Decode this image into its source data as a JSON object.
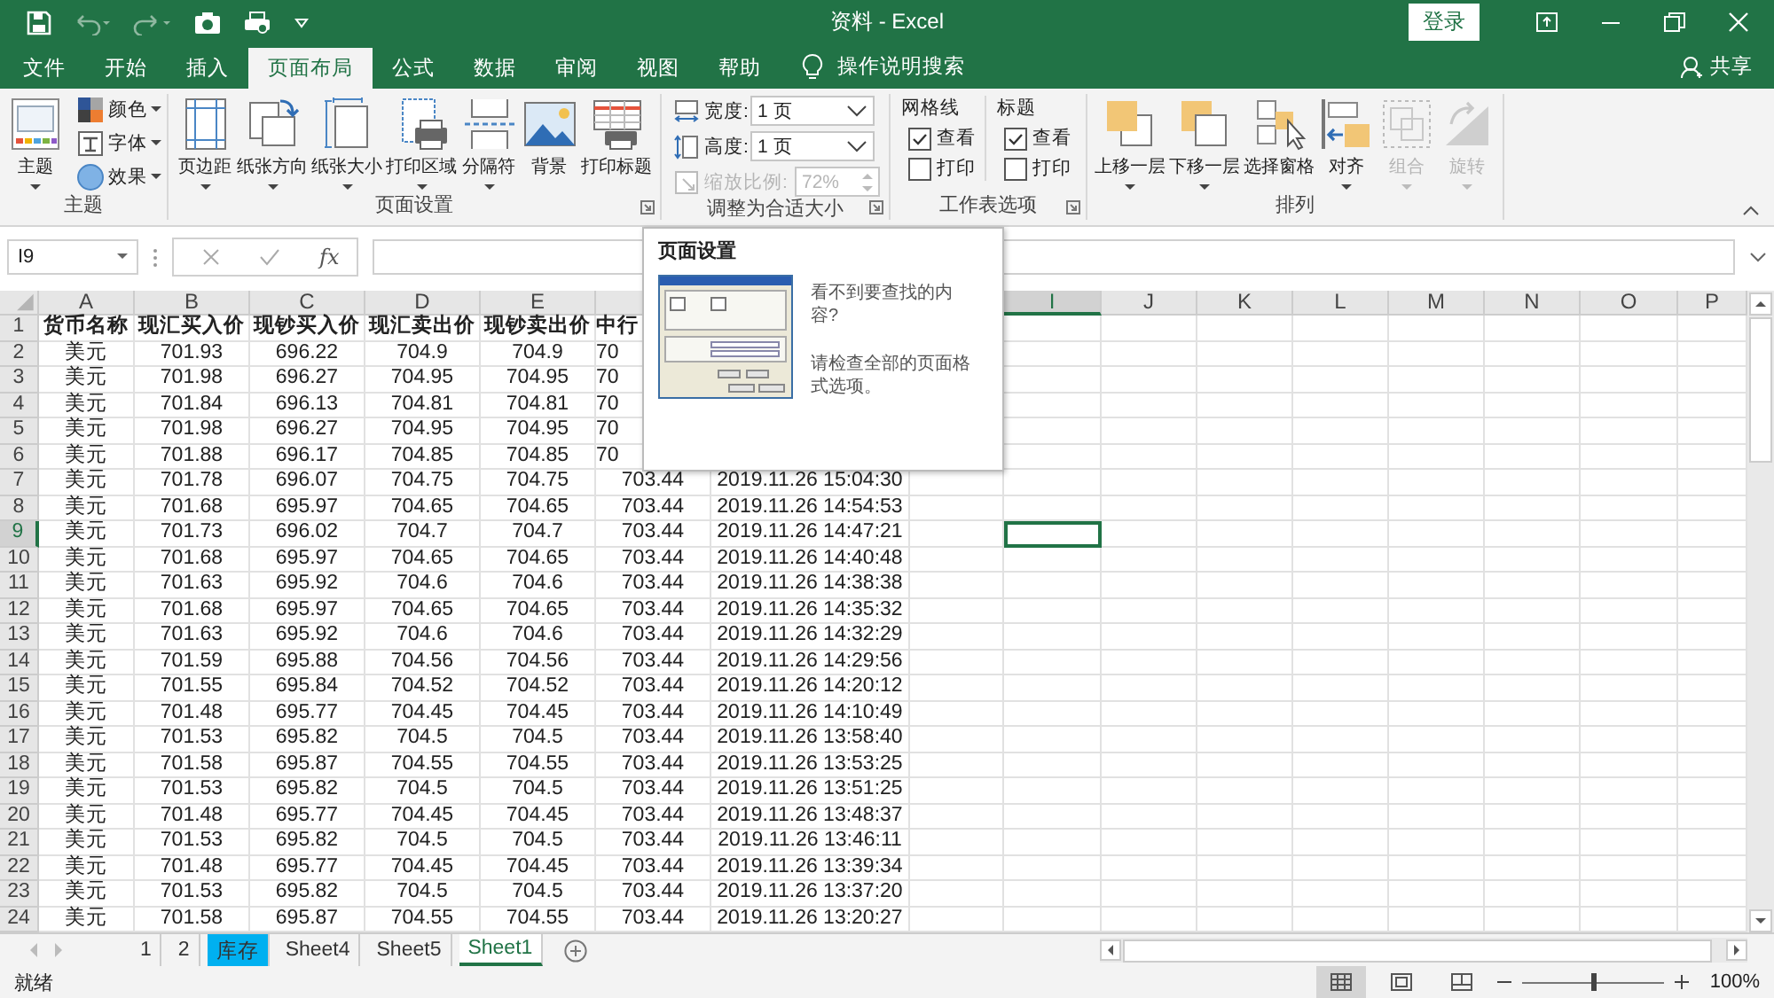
{
  "title_bar": {
    "title": "资料 - Excel",
    "login": "登录"
  },
  "tabs": [
    {
      "label": "文件",
      "selected": false
    },
    {
      "label": "开始",
      "selected": false
    },
    {
      "label": "插入",
      "selected": false
    },
    {
      "label": "页面布局",
      "selected": true
    },
    {
      "label": "公式",
      "selected": false
    },
    {
      "label": "数据",
      "selected": false
    },
    {
      "label": "审阅",
      "selected": false
    },
    {
      "label": "视图",
      "selected": false
    },
    {
      "label": "帮助",
      "selected": false
    }
  ],
  "tell_me": "操作说明搜索",
  "share": "共享",
  "ribbon": [
    {
      "kind": "buttons",
      "label": "主题",
      "launcher": false,
      "items": [
        {
          "label": "主题",
          "dropdown": true,
          "disabled": false
        }
      ],
      "small_items": [
        {
          "label": "颜色",
          "dropdown": true,
          "disabled": false
        },
        {
          "label": "字体",
          "dropdown": true,
          "disabled": false
        },
        {
          "label": "效果",
          "dropdown": true,
          "disabled": false
        }
      ]
    },
    {
      "kind": "buttons",
      "label": "页面设置",
      "launcher": true,
      "items": [
        {
          "label": "页边距",
          "dropdown": true,
          "disabled": false
        },
        {
          "label": "纸张方向",
          "dropdown": true,
          "disabled": false
        },
        {
          "label": "纸张大小",
          "dropdown": true,
          "disabled": false
        },
        {
          "label": "打印区域",
          "dropdown": true,
          "disabled": false
        },
        {
          "label": "分隔符",
          "dropdown": true,
          "disabled": false
        },
        {
          "label": "背景",
          "dropdown": false,
          "disabled": false
        },
        {
          "label": "打印标题",
          "dropdown": false,
          "disabled": false
        }
      ]
    },
    {
      "kind": "fit",
      "label": "调整为合适大小",
      "launcher": true,
      "fields": [
        {
          "kind": "dropdown",
          "label": "宽度:",
          "value": "1 页",
          "disabled": false
        },
        {
          "kind": "dropdown",
          "label": "高度:",
          "value": "1 页",
          "disabled": false
        },
        {
          "kind": "spin",
          "label": "缩放比例:",
          "value": "72%",
          "disabled": true
        }
      ]
    },
    {
      "kind": "options",
      "label": "工作表选项",
      "launcher": true,
      "columns": [
        {
          "title": "网格线",
          "checks": [
            {
              "label": "查看",
              "checked": true
            },
            {
              "label": "打印",
              "checked": false
            }
          ]
        },
        {
          "title": "标题",
          "checks": [
            {
              "label": "查看",
              "checked": true
            },
            {
              "label": "打印",
              "checked": false
            }
          ]
        }
      ]
    },
    {
      "kind": "buttons",
      "label": "排列",
      "launcher": false,
      "items": [
        {
          "label": "上移一层",
          "dropdown": true,
          "disabled": false
        },
        {
          "label": "下移一层",
          "dropdown": true,
          "disabled": false
        },
        {
          "label": "选择窗格",
          "dropdown": false,
          "disabled": false
        },
        {
          "label": "对齐",
          "dropdown": true,
          "disabled": false
        },
        {
          "label": "组合",
          "dropdown": true,
          "disabled": true
        },
        {
          "label": "旋转",
          "dropdown": true,
          "disabled": true
        }
      ]
    }
  ],
  "formula_bar": {
    "name_box": "I9",
    "function_label": "fx"
  },
  "columns": [
    {
      "label": "A",
      "selected": false
    },
    {
      "label": "B",
      "selected": false
    },
    {
      "label": "C",
      "selected": false
    },
    {
      "label": "D",
      "selected": false
    },
    {
      "label": "E",
      "selected": false
    },
    null,
    null,
    null,
    {
      "label": "I",
      "selected": true
    },
    {
      "label": "J",
      "selected": false
    },
    {
      "label": "K",
      "selected": false
    },
    {
      "label": "L",
      "selected": false
    },
    {
      "label": "M",
      "selected": false
    },
    {
      "label": "N",
      "selected": false
    },
    {
      "label": "O",
      "selected": false
    },
    {
      "label": "P",
      "selected": false
    }
  ],
  "rows": [
    {
      "n": "1",
      "selected": false,
      "cells": [
        "货币名称",
        "现汇买入价",
        "现钞买入价",
        "现汇卖出价",
        "现钞卖出价",
        "中行"
      ]
    },
    {
      "n": "2",
      "selected": false,
      "cells": [
        "美元",
        "701.93",
        "696.22",
        "704.9",
        "704.9",
        "70"
      ]
    },
    {
      "n": "3",
      "selected": false,
      "cells": [
        "美元",
        "701.98",
        "696.27",
        "704.95",
        "704.95",
        "70"
      ]
    },
    {
      "n": "4",
      "selected": false,
      "cells": [
        "美元",
        "701.84",
        "696.13",
        "704.81",
        "704.81",
        "70"
      ]
    },
    {
      "n": "5",
      "selected": false,
      "cells": [
        "美元",
        "701.98",
        "696.27",
        "704.95",
        "704.95",
        "70"
      ]
    },
    {
      "n": "6",
      "selected": false,
      "cells": [
        "美元",
        "701.88",
        "696.17",
        "704.85",
        "704.85",
        "70"
      ]
    },
    {
      "n": "7",
      "selected": false,
      "cells": [
        "美元",
        "701.78",
        "696.07",
        "704.75",
        "704.75",
        "703.44",
        "2019.11.26 15:04:30"
      ]
    },
    {
      "n": "8",
      "selected": false,
      "cells": [
        "美元",
        "701.68",
        "695.97",
        "704.65",
        "704.65",
        "703.44",
        "2019.11.26 14:54:53"
      ]
    },
    {
      "n": "9",
      "selected": true,
      "cells": [
        "美元",
        "701.73",
        "696.02",
        "704.7",
        "704.7",
        "703.44",
        "2019.11.26 14:47:21"
      ]
    },
    {
      "n": "10",
      "selected": false,
      "cells": [
        "美元",
        "701.68",
        "695.97",
        "704.65",
        "704.65",
        "703.44",
        "2019.11.26 14:40:48"
      ]
    },
    {
      "n": "11",
      "selected": false,
      "cells": [
        "美元",
        "701.63",
        "695.92",
        "704.6",
        "704.6",
        "703.44",
        "2019.11.26 14:38:38"
      ]
    },
    {
      "n": "12",
      "selected": false,
      "cells": [
        "美元",
        "701.68",
        "695.97",
        "704.65",
        "704.65",
        "703.44",
        "2019.11.26 14:35:32"
      ]
    },
    {
      "n": "13",
      "selected": false,
      "cells": [
        "美元",
        "701.63",
        "695.92",
        "704.6",
        "704.6",
        "703.44",
        "2019.11.26 14:32:29"
      ]
    },
    {
      "n": "14",
      "selected": false,
      "cells": [
        "美元",
        "701.59",
        "695.88",
        "704.56",
        "704.56",
        "703.44",
        "2019.11.26 14:29:56"
      ]
    },
    {
      "n": "15",
      "selected": false,
      "cells": [
        "美元",
        "701.55",
        "695.84",
        "704.52",
        "704.52",
        "703.44",
        "2019.11.26 14:20:12"
      ]
    },
    {
      "n": "16",
      "selected": false,
      "cells": [
        "美元",
        "701.48",
        "695.77",
        "704.45",
        "704.45",
        "703.44",
        "2019.11.26 14:10:49"
      ]
    },
    {
      "n": "17",
      "selected": false,
      "cells": [
        "美元",
        "701.53",
        "695.82",
        "704.5",
        "704.5",
        "703.44",
        "2019.11.26 13:58:40"
      ]
    },
    {
      "n": "18",
      "selected": false,
      "cells": [
        "美元",
        "701.58",
        "695.87",
        "704.55",
        "704.55",
        "703.44",
        "2019.11.26 13:53:25"
      ]
    },
    {
      "n": "19",
      "selected": false,
      "cells": [
        "美元",
        "701.53",
        "695.82",
        "704.5",
        "704.5",
        "703.44",
        "2019.11.26 13:51:25"
      ]
    },
    {
      "n": "20",
      "selected": false,
      "cells": [
        "美元",
        "701.48",
        "695.77",
        "704.45",
        "704.45",
        "703.44",
        "2019.11.26 13:48:37"
      ]
    },
    {
      "n": "21",
      "selected": false,
      "cells": [
        "美元",
        "701.53",
        "695.82",
        "704.5",
        "704.5",
        "703.44",
        "2019.11.26 13:46:11"
      ]
    },
    {
      "n": "22",
      "selected": false,
      "cells": [
        "美元",
        "701.48",
        "695.77",
        "704.45",
        "704.45",
        "703.44",
        "2019.11.26 13:39:34"
      ]
    },
    {
      "n": "23",
      "selected": false,
      "cells": [
        "美元",
        "701.53",
        "695.82",
        "704.5",
        "704.5",
        "703.44",
        "2019.11.26 13:37:20"
      ]
    },
    {
      "n": "24",
      "selected": false,
      "cells": [
        "美元",
        "701.58",
        "695.87",
        "704.55",
        "704.55",
        "703.44",
        "2019.11.26 13:20:27"
      ]
    }
  ],
  "popup": {
    "title": "页面设置",
    "lines": [
      "看不到要查找的内容?",
      "请检查全部的页面格式选项。"
    ]
  },
  "sheet_tabs": [
    {
      "label": "1",
      "selected": false
    },
    {
      "label": "2",
      "selected": false
    },
    {
      "label": "库存",
      "selected": false,
      "color": "#00b0f0"
    },
    {
      "label": "Sheet4",
      "selected": false
    },
    {
      "label": "Sheet5",
      "selected": false
    },
    {
      "label": "Sheet1",
      "selected": true
    }
  ],
  "status_bar": {
    "status": "就绪",
    "views": [
      {
        "selected": true
      },
      {
        "selected": false
      },
      {
        "selected": false
      }
    ],
    "zoom": {
      "level": 0.5,
      "reading": "100%"
    }
  }
}
